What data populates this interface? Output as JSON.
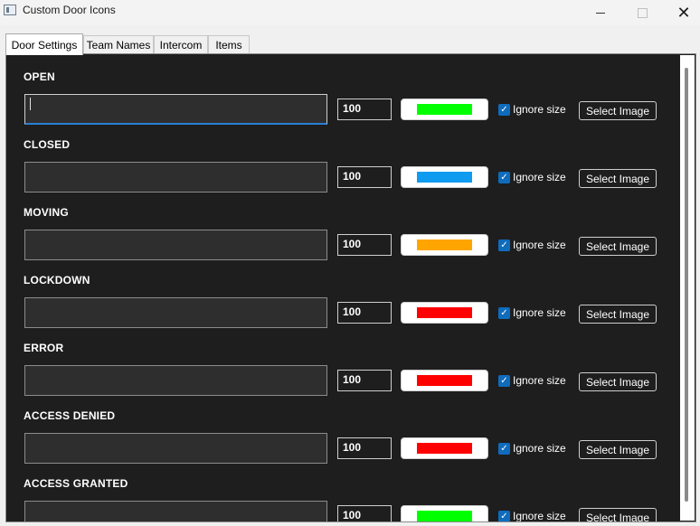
{
  "window": {
    "title": "Custom Door Icons",
    "minimize": "—",
    "maximize": "□",
    "close": "✕"
  },
  "tabs": [
    {
      "label": "Door Settings",
      "active": true
    },
    {
      "label": "Team Names",
      "active": false
    },
    {
      "label": "Intercom",
      "active": false
    },
    {
      "label": "Items",
      "active": false
    }
  ],
  "rows": [
    {
      "label": "OPEN",
      "path": "",
      "size": "100",
      "color": "#00ff00",
      "ignore_size": true,
      "ignore_label": "Ignore size",
      "button": "Select Image"
    },
    {
      "label": "CLOSED",
      "path": "",
      "size": "100",
      "color": "#0f9bef",
      "ignore_size": true,
      "ignore_label": "Ignore size",
      "button": "Select Image"
    },
    {
      "label": "MOVING",
      "path": "",
      "size": "100",
      "color": "#ffa500",
      "ignore_size": true,
      "ignore_label": "Ignore size",
      "button": "Select Image"
    },
    {
      "label": "LOCKDOWN",
      "path": "",
      "size": "100",
      "color": "#ff0000",
      "ignore_size": true,
      "ignore_label": "Ignore size",
      "button": "Select Image"
    },
    {
      "label": "ERROR",
      "path": "",
      "size": "100",
      "color": "#ff0000",
      "ignore_size": true,
      "ignore_label": "Ignore size",
      "button": "Select Image"
    },
    {
      "label": "ACCESS DENIED",
      "path": "",
      "size": "100",
      "color": "#ff0000",
      "ignore_size": true,
      "ignore_label": "Ignore size",
      "button": "Select Image"
    },
    {
      "label": "ACCESS GRANTED",
      "path": "",
      "size": "100",
      "color": "#00ff00",
      "ignore_size": true,
      "ignore_label": "Ignore size",
      "button": "Select Image"
    }
  ],
  "icons": {
    "app": "app-window-icon",
    "checkmark": "✓"
  }
}
